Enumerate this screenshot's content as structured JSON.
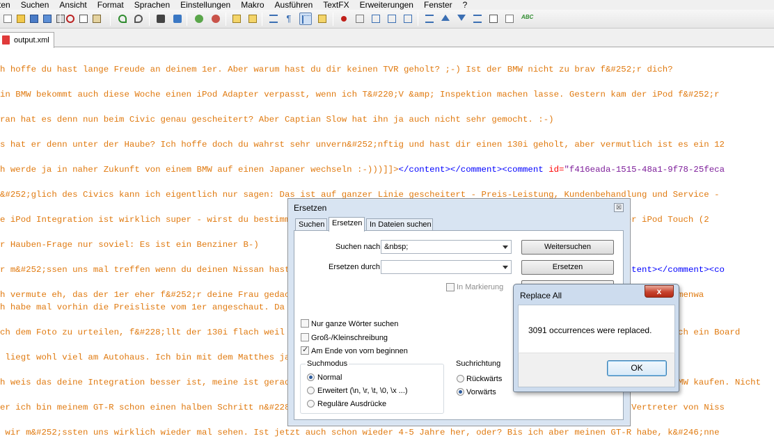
{
  "menu": [
    "ten",
    "Suchen",
    "Ansicht",
    "Format",
    "Sprachen",
    "Einstellungen",
    "Makro",
    "Ausführen",
    "TextFX",
    "Erweiterungen",
    "Fenster",
    "?"
  ],
  "tab": {
    "label": "output.xml"
  },
  "editor_lines": [
    {
      "text": "h hoffe du hast lange Freude an deinem 1er. Aber warum hast du dir keinen TVR geholt? ;-) Ist der BMW nicht zu brav f&#252;r dich?"
    },
    {
      "text": "in BMW bekommt auch diese Woche einen iPod Adapter verpasst, wenn ich T&#220;V &amp; Inspektion machen lasse. Gestern kam der iPod f&#252;r"
    },
    {
      "text": "ran hat es denn nun beim Civic genau gescheitert? Aber Captian Slow hat ihn ja auch nicht sehr gemocht. :-)"
    },
    {
      "text": "s hat er denn unter der Haube? Ich hoffe doch du wahrst sehr unvern&#252;nftig und hast dir einen 130i geholt, aber vermutlich ist es ein 12"
    },
    {
      "text": "h werde ja in naher Zukunft von einem BMW auf einen Japaner wechseln :-)))]]>",
      "tail": [
        {
          "t": "</content></comment><comment ",
          "c": "tag"
        },
        {
          "t": "id=",
          "c": "attr"
        },
        {
          "t": "\"f416eada-1515-48a1-9f78-25feca",
          "c": "str"
        }
      ]
    },
    {
      "text": "&#252;glich des Civics kann ich eigentlich nur sagen: Das ist auf ganzer Linie gescheitert - Preis-Leistung, Kundenbehandlung und Service -"
    },
    {
      "text": "e iPod Integration ist wirklich super - wirst du bestimmt Freude dran haben - bei unserem BMW ist es allerdings so dass der iPod Touch (2"
    },
    {
      "text": "r Hauben-Frage nur soviel: Es ist ein Benziner B-)"
    },
    {
      "text": "r m&#252;ssen uns mal treffen wenn du deinen Nissan hast - auf das Auto bin ich n&#228;mlich auch extrem gespannt.]]>",
      "tail": [
        {
          "t": "</content></comment><co",
          "c": "tag"
        }
      ]
    },
    {
      "text": "h vermute eh, das der 1er eher f&#252;r deine Frau gedacht ist. Fr&#252;her oder sp&#228;ter wird es ja doch einen 3er oder 5er Firmenwa",
      "text2": "h habe mal vorhin die Preisliste vom 1er angeschaut. Da gibt es viele nette aufpreis pflichtige Optionen."
    },
    {
      "text": "ch dem Foto zu urteilen, f&#228;llt der 130i flach weil er Zylinder hat. Ich w&#252;rde jetzt auch einen aus Holland kaufen. Ist auch ein Board"
    },
    {
      "text": " liegt wohl viel am Autohaus. Ich bin mit dem Matthes ja auch zufrieden, schade das sie nicht mehr Autos haben."
    },
    {
      "text": "h weis das deine Integration besser ist, meine ist geradezu light dagegen. Aber ich w&#252;rde nie wieder einen anderen als einen BMW kaufen. Nicht"
    },
    {
      "text": "er ich bin meinem GT-R schon einen halben Schritt n&#228;her. In der Firma haben wir jetzt einen Berater, der kennt einen Vertreter von Niss"
    },
    {
      "text": " wir m&#252;ssten uns wirklich wieder mal sehen. Ist jetzt auch schon wieder 4-5 Jahre her, oder? Bis ich aber meinen GT-R habe, k&#246;nne"
    }
  ],
  "replace_dialog": {
    "title": "Ersetzen",
    "close": "☒",
    "tabs": [
      "Suchen",
      "Ersetzen",
      "In Dateien suchen"
    ],
    "find_label": "Suchen nach",
    "find_value": "&nbsp;",
    "replace_label": "Ersetzen durch",
    "replace_value": "",
    "btn_find_next": "Weitersuchen",
    "btn_replace": "Ersetzen",
    "in_selection": "In Markierung",
    "opt_whole_words": "Nur ganze Wörter suchen",
    "opt_match_case": "Groß-/Kleinschreibung",
    "opt_wrap": "Am Ende von vorn beginnen",
    "search_mode_title": "Suchmodus",
    "mode_normal": "Normal",
    "mode_extended": "Erweitert (\\n, \\r, \\t, \\0, \\x ...)",
    "mode_regex": "Reguläre Ausdrücke",
    "direction_title": "Suchrichtung",
    "dir_back": "Rückwärts",
    "dir_fwd": "Vorwärts",
    "transparency": "immer"
  },
  "msgbox": {
    "title": "Replace All",
    "message": "3091 occurrences were replaced.",
    "ok": "OK",
    "close": "x"
  },
  "colors": {
    "text": "#e07a10",
    "tag": "#0000ff",
    "attr": "#ff0000",
    "string": "#7e1f9b",
    "dialog_bg": "#d8e4f2"
  }
}
